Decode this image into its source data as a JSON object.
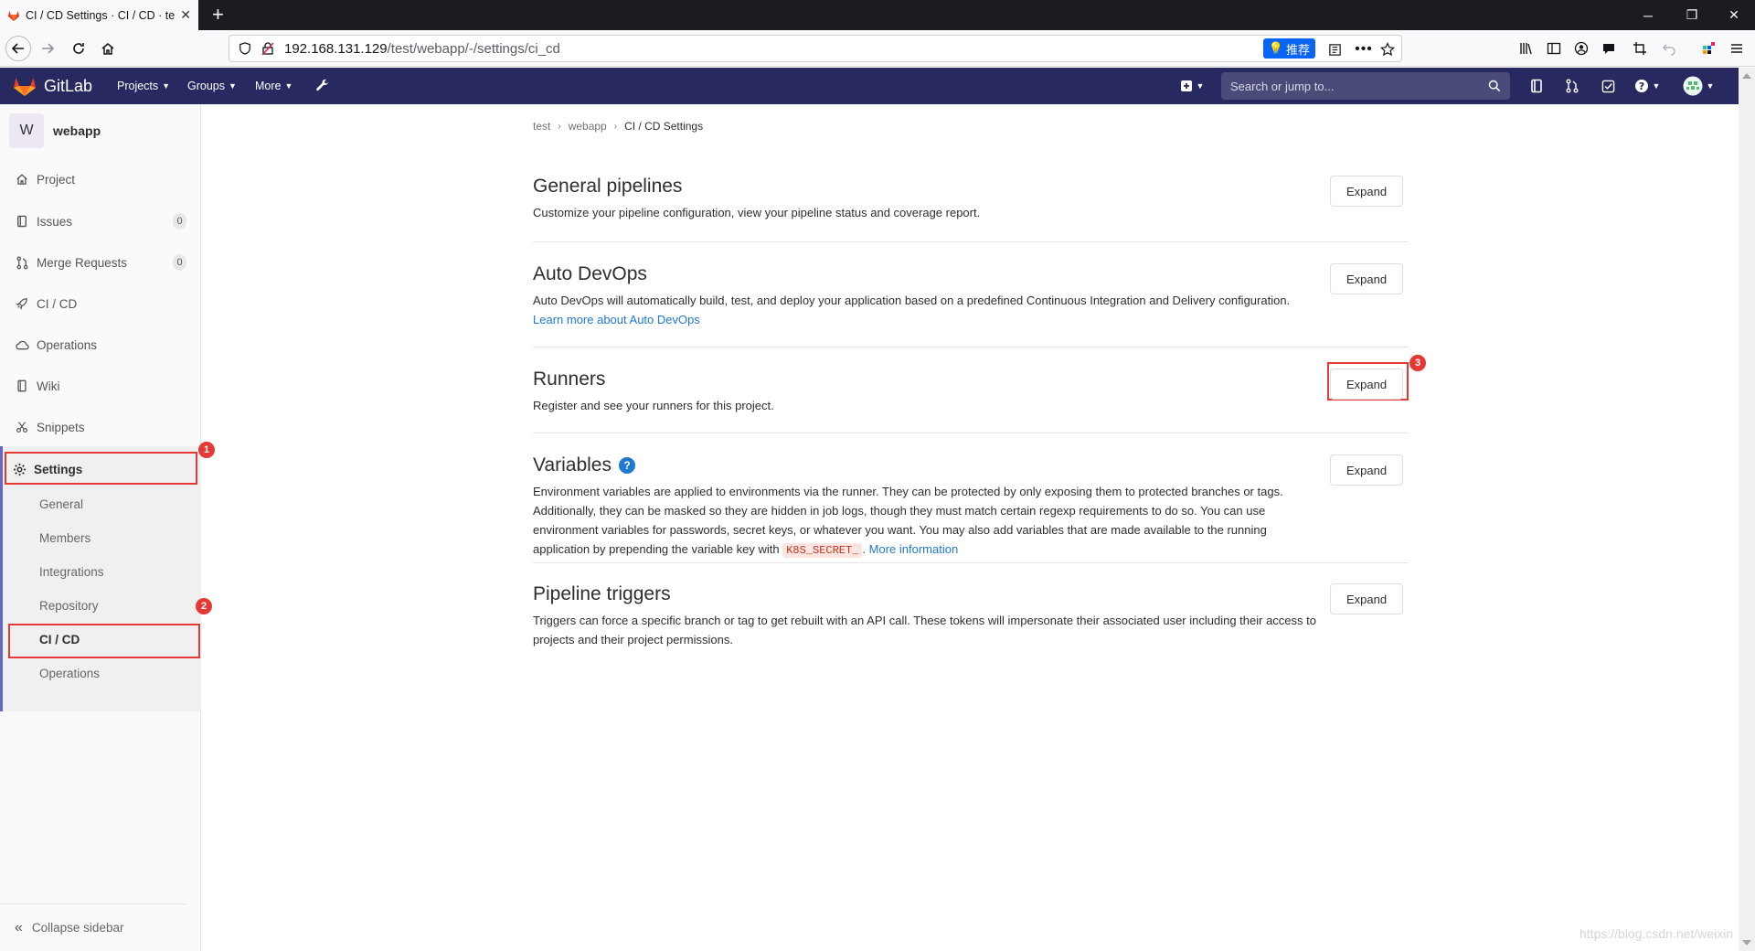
{
  "browser": {
    "tab_title": "CI / CD Settings · CI / CD · te",
    "url_host": "192.168.131.129",
    "url_path": "/test/webapp/-/settings/ci_cd",
    "recommend_label": "推荐"
  },
  "header": {
    "brand": "GitLab",
    "menu": [
      "Projects",
      "Groups",
      "More"
    ],
    "search_placeholder": "Search or jump to..."
  },
  "sidebar": {
    "project_initial": "W",
    "project_name": "webapp",
    "items": [
      {
        "label": "Project"
      },
      {
        "label": "Issues",
        "count": "0"
      },
      {
        "label": "Merge Requests",
        "count": "0"
      },
      {
        "label": "CI / CD"
      },
      {
        "label": "Operations"
      },
      {
        "label": "Wiki"
      },
      {
        "label": "Snippets"
      },
      {
        "label": "Settings"
      }
    ],
    "settings_sub": [
      "General",
      "Members",
      "Integrations",
      "Repository",
      "CI / CD",
      "Operations"
    ],
    "collapse_label": "Collapse sidebar"
  },
  "markers": [
    "1",
    "2",
    "3"
  ],
  "breadcrumb": [
    "test",
    "webapp",
    "CI / CD Settings"
  ],
  "sections": {
    "general": {
      "title": "General pipelines",
      "desc": "Customize your pipeline configuration, view your pipeline status and coverage report."
    },
    "autodevops": {
      "title": "Auto DevOps",
      "desc": "Auto DevOps will automatically build, test, and deploy your application based on a predefined Continuous Integration and Delivery configuration.",
      "link": "Learn more about Auto DevOps"
    },
    "runners": {
      "title": "Runners",
      "desc": "Register and see your runners for this project."
    },
    "variables": {
      "title": "Variables",
      "desc": "Environment variables are applied to environments via the runner. They can be protected by only exposing them to protected branches or tags. Additionally, they can be masked so they are hidden in job logs, though they must match certain regexp requirements to do so. You can use environment variables for passwords, secret keys, or whatever you want. You may also add variables that are made available to the running application by prepending the variable key with",
      "code": "K8S_SECRET_",
      "suffix": ".",
      "link": "More information"
    },
    "triggers": {
      "title": "Pipeline triggers",
      "desc": "Triggers can force a specific branch or tag to get rebuilt with an API call. These tokens will impersonate their associated user including their access to projects and their project permissions."
    }
  },
  "expand_label": "Expand",
  "watermark": "https://blog.csdn.net/weixin",
  "colors": {
    "header_bg": "#292961",
    "accent": "#6666c4",
    "link": "#1f78d1",
    "highlight": "#e53935"
  }
}
